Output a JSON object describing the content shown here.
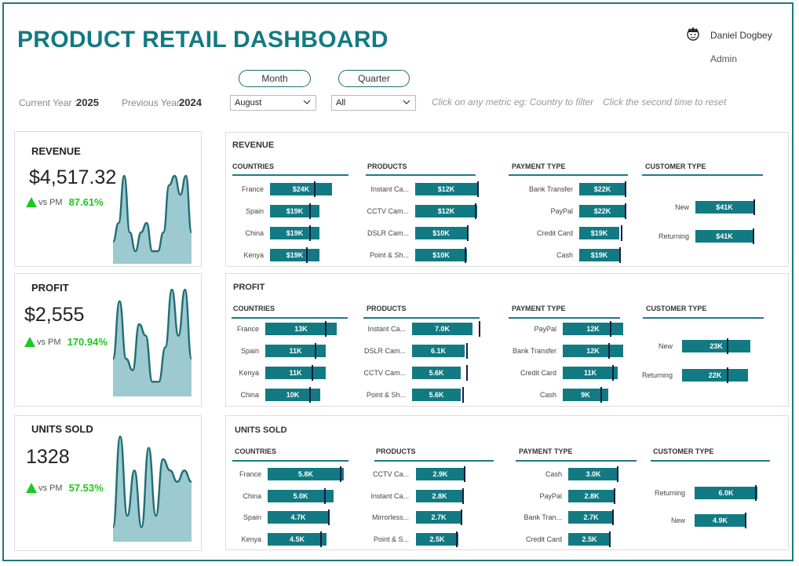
{
  "title": "PRODUCT RETAIL DASHBOARD",
  "user": {
    "name": "Daniel Dogbey",
    "role": "Admin",
    "avatar_icon": "user-avatar-icon"
  },
  "filters": {
    "month_btn": "Month",
    "quarter_btn": "Quarter",
    "month_value": "August",
    "quarter_value": "All",
    "current_year_label": "Current Year :",
    "current_year": "2025",
    "previous_year_label": "Previous Year :",
    "previous_year": "2024",
    "hint1": "Click on any metric eg: Country to filter",
    "hint2": "Click the second time to reset"
  },
  "colors": {
    "accent": "#127a82",
    "up": "#1ec81e",
    "area": "#9ccad0"
  },
  "kpis": [
    {
      "label": "REVENUE",
      "value": "$4,517.32",
      "vs": "vs PM",
      "pct": "87.61%",
      "spark": [
        2,
        4,
        9,
        3,
        1,
        3,
        4,
        1,
        1,
        3,
        8,
        9,
        7,
        9,
        3
      ]
    },
    {
      "label": "PROFIT",
      "value": "$2,555",
      "vs": "vs PM",
      "pct": "170.94%",
      "spark": [
        3,
        8,
        3,
        2,
        6,
        5,
        1,
        1,
        4,
        9,
        5,
        9,
        3
      ]
    },
    {
      "label": "UNITS SOLD",
      "value": "1328",
      "vs": "vs PM",
      "pct": "57.53%",
      "spark": [
        1,
        9,
        2,
        6,
        1,
        8,
        2,
        7,
        6,
        5,
        6,
        5
      ]
    }
  ],
  "panels": [
    {
      "title": "REVENUE",
      "sections": [
        {
          "header": "COUNTRIES",
          "rows": [
            {
              "label": "France",
              "text": "$24K",
              "value": 24,
              "target": 17
            },
            {
              "label": "Spain",
              "text": "$19K",
              "value": 19,
              "target": 15
            },
            {
              "label": "China",
              "text": "$19K",
              "value": 19,
              "target": 15
            },
            {
              "label": "Kenya",
              "text": "$19K",
              "value": 19,
              "target": 14
            }
          ]
        },
        {
          "header": "PRODUCTS",
          "rows": [
            {
              "label": "Instant Ca...",
              "text": "$12K",
              "value": 12,
              "target": 12
            },
            {
              "label": "CCTV Cam...",
              "text": "$12K",
              "value": 12,
              "target": 11.5
            },
            {
              "label": "DSLR Cam...",
              "text": "$10K",
              "value": 10,
              "target": 10
            },
            {
              "label": "Point & Sh...",
              "text": "$10K",
              "value": 10,
              "target": 9.5
            }
          ]
        },
        {
          "header": "PAYMENT TYPE",
          "rows": [
            {
              "label": "Bank Transfer",
              "text": "$22K",
              "value": 22,
              "target": 21.5
            },
            {
              "label": "PayPal",
              "text": "$22K",
              "value": 22,
              "target": 21.5
            },
            {
              "label": "Credit Card",
              "text": "$19K",
              "value": 19,
              "target": 19.5
            },
            {
              "label": "Cash",
              "text": "$19K",
              "value": 19,
              "target": 19
            }
          ]
        },
        {
          "header": "CUSTOMER TYPE",
          "rows": [
            {
              "label": "New",
              "text": "$41K",
              "value": 41,
              "target": 41
            },
            {
              "label": "Returning",
              "text": "$41K",
              "value": 41,
              "target": 40.5
            }
          ]
        }
      ]
    },
    {
      "title": "PROFIT",
      "sections": [
        {
          "header": "COUNTRIES",
          "rows": [
            {
              "label": "France",
              "text": "13K",
              "value": 13,
              "target": 10.8
            },
            {
              "label": "Spain",
              "text": "11K",
              "value": 11,
              "target": 9
            },
            {
              "label": "Kenya",
              "text": "11K",
              "value": 11,
              "target": 8.4
            },
            {
              "label": "China",
              "text": "10K",
              "value": 10,
              "target": 8
            }
          ]
        },
        {
          "header": "PRODUCTS",
          "rows": [
            {
              "label": "Instant Ca...",
              "text": "7.0K",
              "value": 7.0,
              "target": 7.7
            },
            {
              "label": "DSLR Cam...",
              "text": "6.1K",
              "value": 6.1,
              "target": 6.3
            },
            {
              "label": "CCTV Cam...",
              "text": "5.6K",
              "value": 5.6,
              "target": 6.3
            },
            {
              "label": "Point & Sh...",
              "text": "5.6K",
              "value": 5.6,
              "target": 5.8
            }
          ]
        },
        {
          "header": "PAYMENT TYPE",
          "rows": [
            {
              "label": "PayPal",
              "text": "12K",
              "value": 12,
              "target": 9.3
            },
            {
              "label": "Bank Transfer",
              "text": "12K",
              "value": 12,
              "target": 9
            },
            {
              "label": "Credit Card",
              "text": "11K",
              "value": 11,
              "target": 9.8
            },
            {
              "label": "Cash",
              "text": "9K",
              "value": 9,
              "target": 7.5
            }
          ]
        },
        {
          "header": "CUSTOMER TYPE",
          "rows": [
            {
              "label": "New",
              "text": "23K",
              "value": 23,
              "target": 15
            },
            {
              "label": "Returning",
              "text": "22K",
              "value": 22,
              "target": 15
            }
          ]
        }
      ]
    },
    {
      "title": "UNITS SOLD",
      "sections": [
        {
          "header": "COUNTRIES",
          "rows": [
            {
              "label": "France",
              "text": "5.8K",
              "value": 5.8,
              "target": 5.5
            },
            {
              "label": "China",
              "text": "5.0K",
              "value": 5.0,
              "target": 4.3
            },
            {
              "label": "Spain",
              "text": "4.7K",
              "value": 4.7,
              "target": 4.6
            },
            {
              "label": "Kenya",
              "text": "4.5K",
              "value": 4.5,
              "target": 4.0
            }
          ]
        },
        {
          "header": "PRODUCTS",
          "rows": [
            {
              "label": "CCTV Ca...",
              "text": "2.9K",
              "value": 2.9,
              "target": 2.85
            },
            {
              "label": "Instant Ca...",
              "text": "2.8K",
              "value": 2.8,
              "target": 2.75
            },
            {
              "label": "Mirrorless...",
              "text": "2.7K",
              "value": 2.7,
              "target": 2.65
            },
            {
              "label": "Point & S...",
              "text": "2.5K",
              "value": 2.5,
              "target": 2.4
            }
          ]
        },
        {
          "header": "PAYMENT TYPE",
          "rows": [
            {
              "label": "Cash",
              "text": "3.0K",
              "value": 3.0,
              "target": 2.9
            },
            {
              "label": "PayPal",
              "text": "2.8K",
              "value": 2.8,
              "target": 2.72
            },
            {
              "label": "Bank Tran...",
              "text": "2.7K",
              "value": 2.7,
              "target": 2.6
            },
            {
              "label": "Credit Card",
              "text": "2.5K",
              "value": 2.5,
              "target": 2.45
            }
          ]
        },
        {
          "header": "CUSTOMER TYPE",
          "rows": [
            {
              "label": "Returning",
              "text": "6.0K",
              "value": 6.0,
              "target": 5.8
            },
            {
              "label": "New",
              "text": "4.9K",
              "value": 4.9,
              "target": 4.8
            }
          ]
        }
      ]
    }
  ]
}
